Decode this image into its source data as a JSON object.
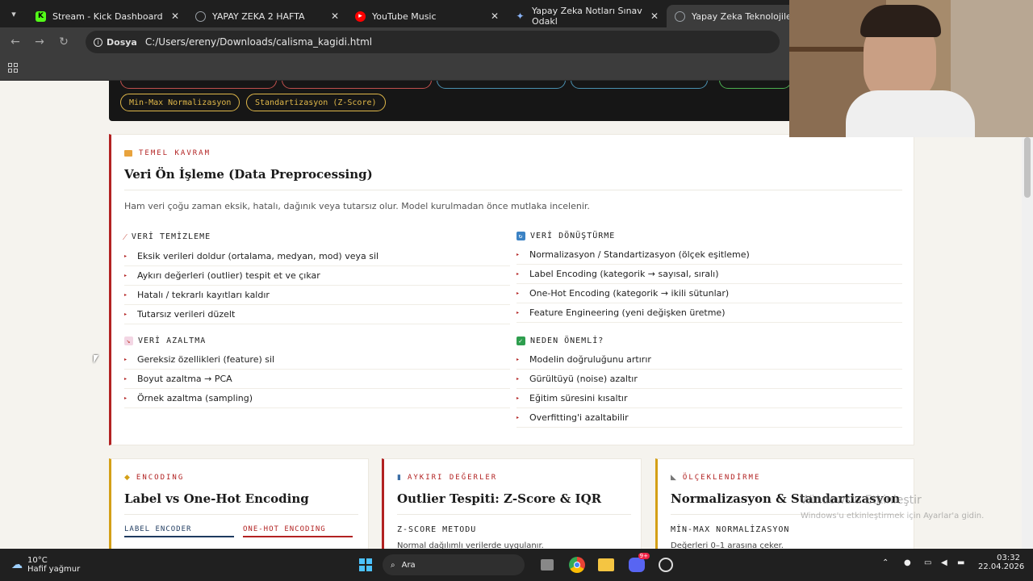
{
  "browser": {
    "tabs": [
      {
        "label": "Stream - Kick Dashboard",
        "icon": "kick-icon",
        "color": "#53fc18",
        "active": false
      },
      {
        "label": "YAPAY ZEKA 2 HAFTA",
        "icon": "globe-icon",
        "color": "#9aa0a6",
        "active": false
      },
      {
        "label": "YouTube Music",
        "icon": "youtube-music-icon",
        "color": "#ff0000",
        "active": false
      },
      {
        "label": "Yapay Zeka Notları Sınav Odakl",
        "icon": "gemini-icon",
        "color": "#8ab4f8",
        "active": false
      },
      {
        "label": "Yapay Zeka Teknolojileri – Sı",
        "icon": "globe-icon",
        "color": "#9aa0a6",
        "active": true
      }
    ],
    "site_chip": "Dosya",
    "url": "C:/Users/ereny/Downloads/calisma_kagidi.html"
  },
  "top_pills": [
    {
      "label": "Min-Max Normalizasyon",
      "color": "#e0b84a"
    },
    {
      "label": "Standartizasyon (Z-Score)",
      "color": "#e0b84a"
    }
  ],
  "main_card": {
    "kicker": "TEMEL KAVRAM",
    "kicker_icon": "folder-icon",
    "title": "Veri Ön İşleme (Data Preprocessing)",
    "intro": "Ham veri çoğu zaman eksik, hatalı, dağınık veya tutarsız olur. Model kurulmadan önce mutlaka incelenir.",
    "sections": [
      {
        "title": "VERİ TEMİZLEME",
        "icon": "broom-icon",
        "items": [
          "Eksik verileri doldur (ortalama, medyan, mod) veya sil",
          "Aykırı değerleri (outlier) tespit et ve çıkar",
          "Hatalı / tekrarlı kayıtları kaldır",
          "Tutarsız verileri düzelt"
        ]
      },
      {
        "title": "VERİ DÖNÜŞTÜRME",
        "icon": "refresh-icon",
        "items": [
          "Normalizasyon / Standartizasyon (ölçek eşitleme)",
          "Label Encoding (kategorik → sayısal, sıralı)",
          "One-Hot Encoding (kategorik → ikili sütunlar)",
          "Feature Engineering (yeni değişken üretme)"
        ]
      },
      {
        "title": "VERİ AZALTMA",
        "icon": "chart-down-icon",
        "items": [
          "Gereksiz özellikleri (feature) sil",
          "Boyut azaltma → PCA",
          "Örnek azaltma (sampling)"
        ]
      },
      {
        "title": "NEDEN ÖNEMLİ?",
        "icon": "check-icon",
        "items": [
          "Modelin doğruluğunu artırır",
          "Gürültüyü (noise) azaltır",
          "Eğitim süresini kısaltır",
          "Overfitting'i azaltabilir"
        ]
      }
    ]
  },
  "cards": [
    {
      "kicker": "ENCODING",
      "kicker_icon": "tag-icon",
      "title": "Label vs One-Hot Encoding",
      "sub_a": "LABEL ENCODER",
      "sub_b": "ONE-HOT ENCODING"
    },
    {
      "kicker": "AYKIRI DEĞERLER",
      "kicker_icon": "bar-chart-icon",
      "title": "Outlier Tespiti: Z-Score & IQR",
      "sub": "Z-SCORE METODU",
      "text": "Normal dağılımlı verilerde uygulanır."
    },
    {
      "kicker": "ÖLÇEKLENDİRME",
      "kicker_icon": "ruler-icon",
      "title": "Normalizasyon & Standartizasyon",
      "sub": "MİN-MAX NORMALİZASYON",
      "text": "Değerleri 0–1 arasına çeker."
    }
  ],
  "watermark": {
    "title": "Windows'u Etkinleştir",
    "text": "Windows'u etkinleştirmek için Ayarlar'a gidin."
  },
  "taskbar": {
    "temp": "10°C",
    "weather": "Hafif yağmur",
    "search": "Ara",
    "time": "03:32",
    "date": "22.04.2026",
    "badge": "9+"
  }
}
